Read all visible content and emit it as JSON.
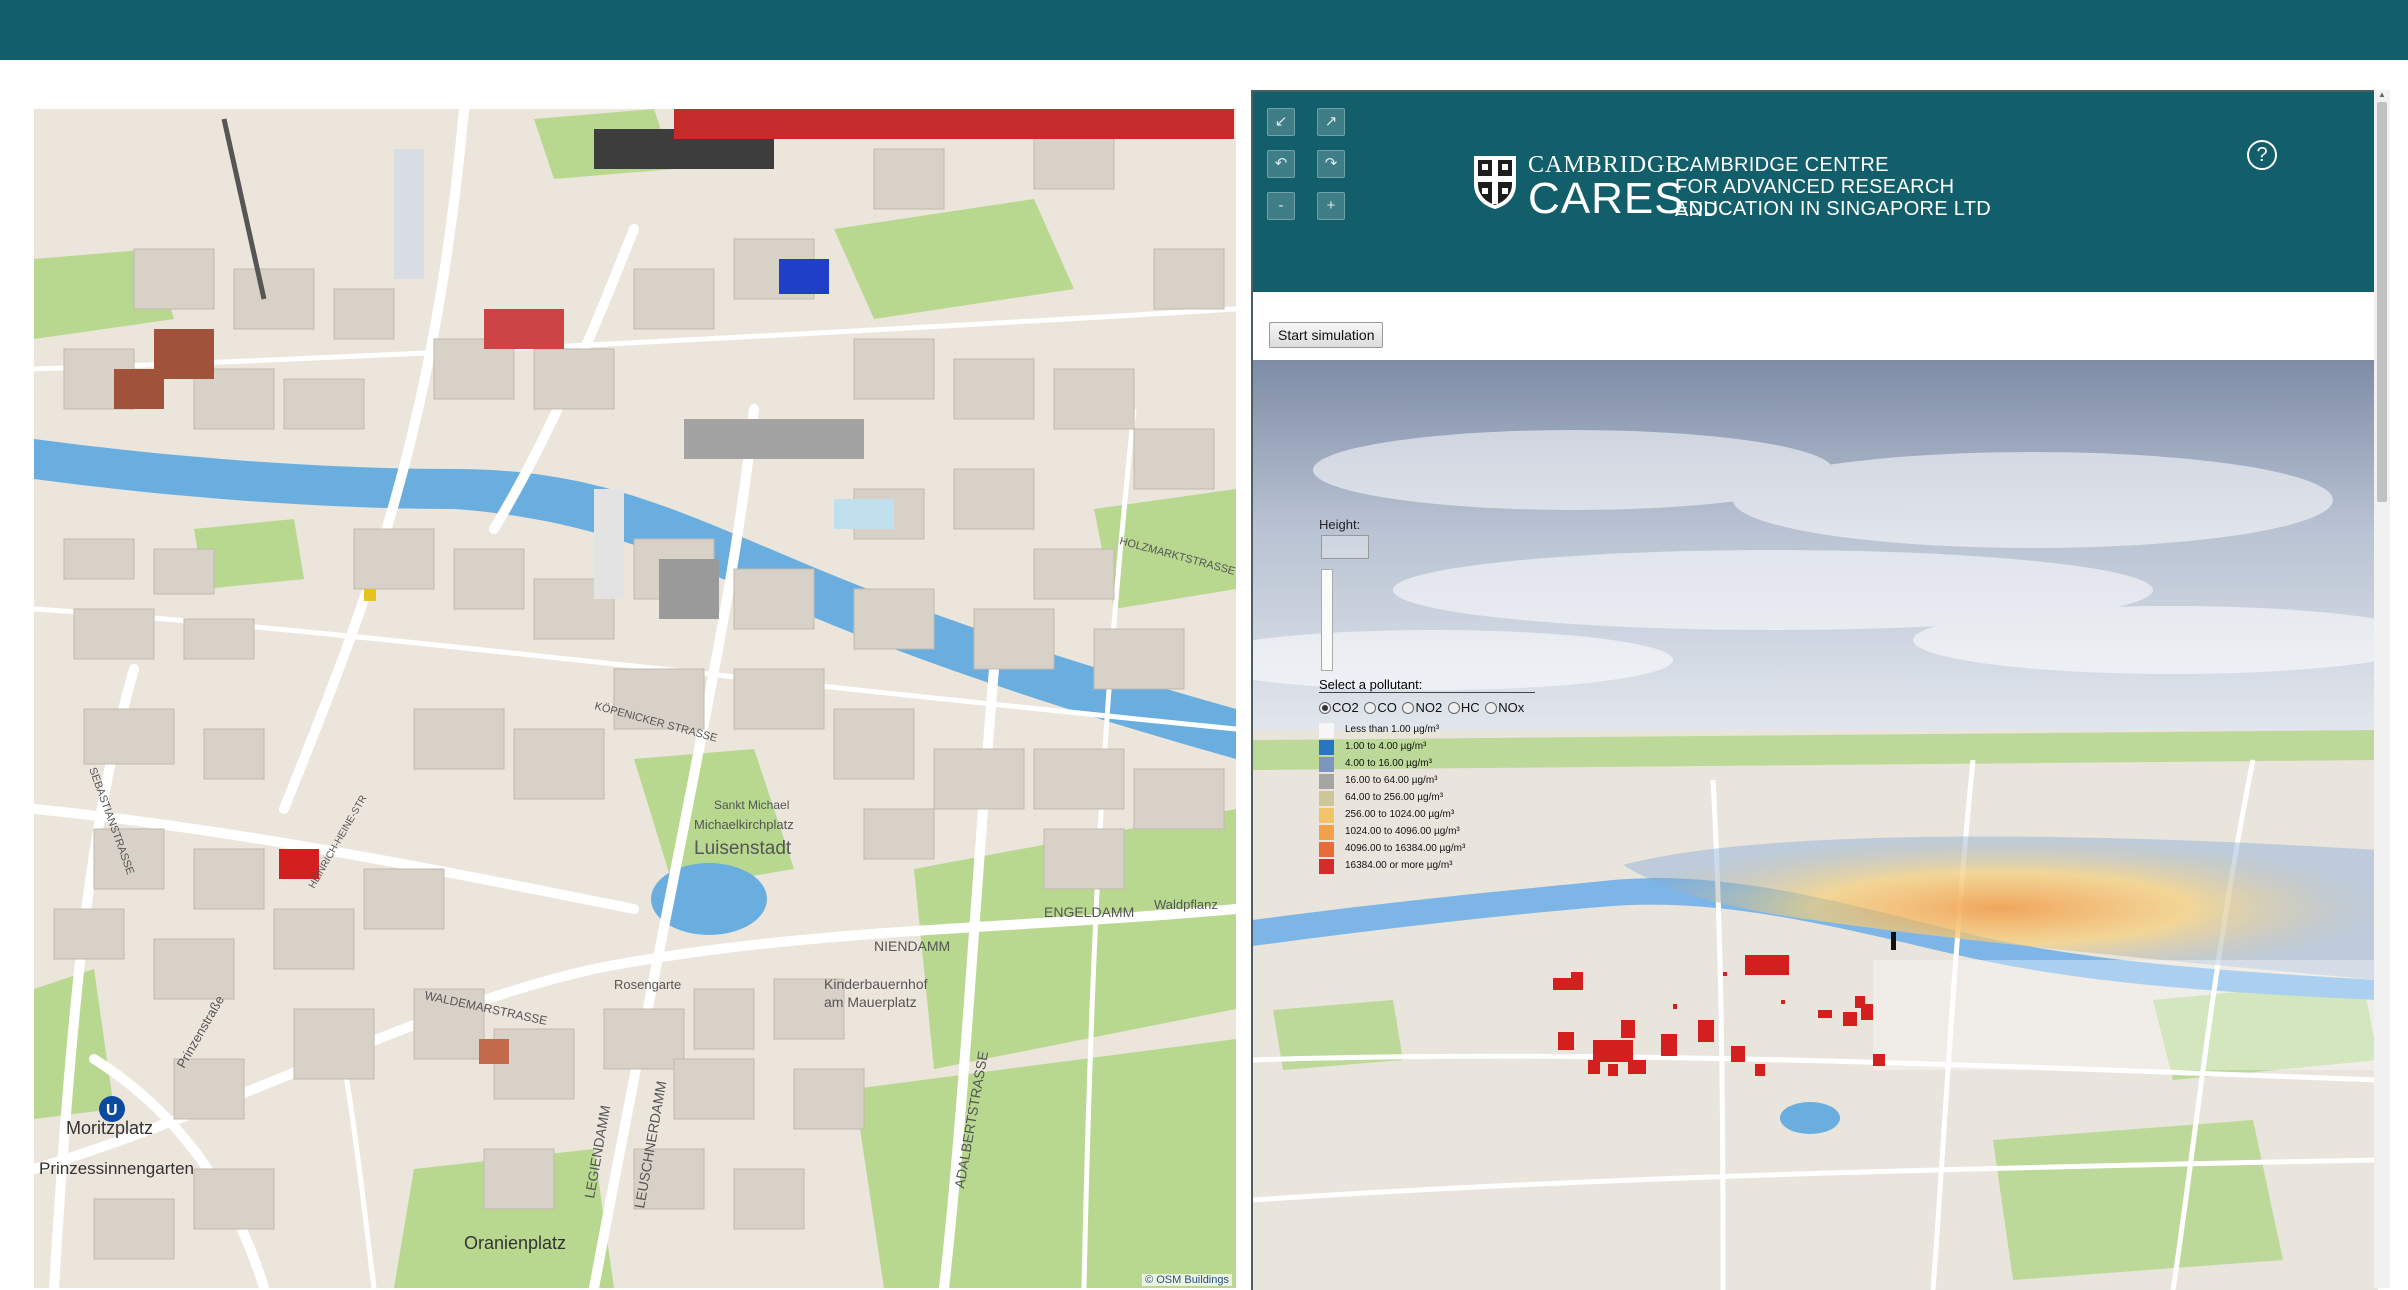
{
  "map": {
    "attribution": "© OSM Buildings",
    "labels": {
      "luisenstadt": "Luisenstadt",
      "michaelkirchplatz": "Michaelkirchplatz",
      "sankt_michael": "Sankt Michael",
      "engeldamm": "ENGELDAMM",
      "waldpflanz": "Waldpflanz",
      "niendamm": "NIENDAMM",
      "kinderbauernhof": "Kinderbauernhof",
      "am_mauerplatz": "am Mauerplatz",
      "adalbertstrasse": "ADALBERTSTRASSE",
      "leuschnerdamm": "LEUSCHNERDAMM",
      "legiendamm": "LEGIENDAMM",
      "waldemarstrasse": "WALDEMARSTRASSE",
      "rosengarten": "Rosengarte",
      "moritzplatz": "Moritzplatz",
      "u": "U",
      "prinzessinnengarten": "Prinzessinnengarten",
      "prinzenstrasse": "Prinzenstraße",
      "oranienplatz": "Oranienplatz",
      "sebastianstrasse": "SEBASTIANSTRASSE",
      "holzmarkt": "HOLZMARKTSTRASSE",
      "koepenicker": "KÖPENICKER STRASSE",
      "heinrich_heine": "HEINRICH-HEINE-STR"
    }
  },
  "panel": {
    "logo": {
      "word1": "CAMBRIDGE",
      "word2": "CARES",
      "line1": "CAMBRIDGE CENTRE",
      "line2": "FOR ADVANCED RESEARCH AND",
      "line3": "EDUCATION IN SINGAPORE LTD"
    },
    "help": "?",
    "nav": {
      "down_left": "↙",
      "up_right": "↗",
      "rotate_left": "↶",
      "rotate_right": "↷",
      "zoom_out": "-",
      "zoom_in": "+"
    },
    "start_button": "Start simulation",
    "height_label": "Height:",
    "height_value": "",
    "pollutant_label": "Select a pollutant:",
    "pollutants": [
      "CO2",
      "CO",
      "NO2",
      "HC",
      "NOx"
    ],
    "selected_pollutant": "CO2",
    "legend": [
      {
        "label": "Less than 1.00 µg/m³",
        "color": "#f7f7f7"
      },
      {
        "label": "1.00 to 4.00 µg/m³",
        "color": "#2a74c4"
      },
      {
        "label": "4.00 to 16.00 µg/m³",
        "color": "#7d96c0"
      },
      {
        "label": "16.00 to 64.00 µg/m³",
        "color": "#a5a5a5"
      },
      {
        "label": "64.00 to 256.00 µg/m³",
        "color": "#cfc79a"
      },
      {
        "label": "256.00 to 1024.00 µg/m³",
        "color": "#f2c36b"
      },
      {
        "label": "1024.00 to 4096.00 µg/m³",
        "color": "#f2a04a"
      },
      {
        "label": "4096.00 to 16384.00 µg/m³",
        "color": "#e86b3a"
      },
      {
        "label": "16384.00 or more µg/m³",
        "color": "#d42b2b"
      }
    ]
  }
}
